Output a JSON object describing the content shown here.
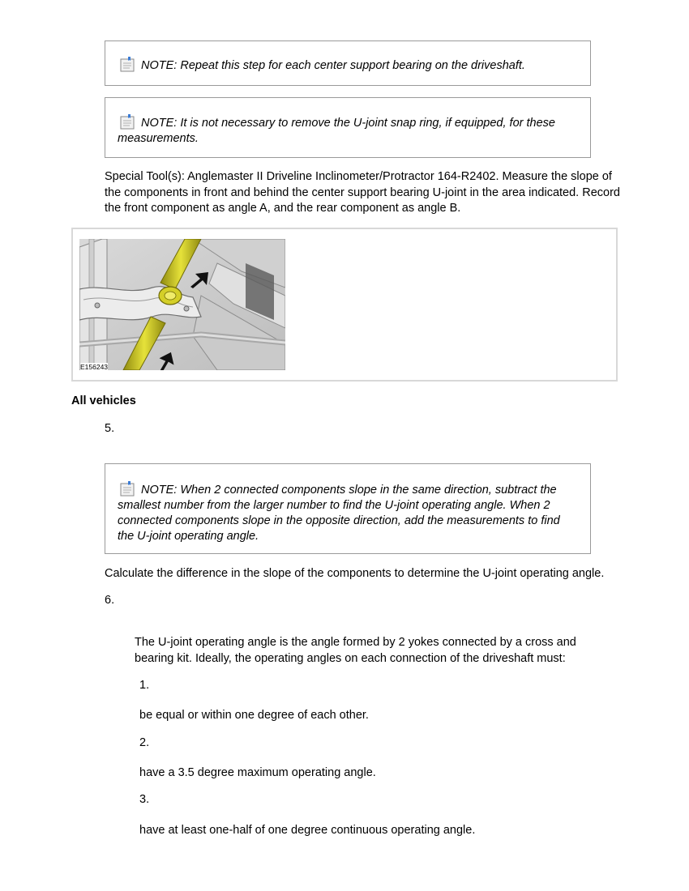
{
  "notes": [
    {
      "label": "NOTE:",
      "text": "Repeat this step for each center support bearing on the driveshaft."
    },
    {
      "label": "NOTE:",
      "text": "It is not necessary to remove the U-joint snap ring, if equipped, for these measurements."
    },
    {
      "label": "NOTE:",
      "text": "When 2 connected components slope in the same direction, subtract the smallest number from the larger number to find the U-joint operating angle. When 2 connected components slope in the opposite direction, add the measurements to find the U-joint operating angle."
    }
  ],
  "special_tool_paragraph": "Special Tool(s): Anglemaster II Driveline Inclinometer/Protractor 164-R2402. Measure the slope of the components in front and behind the center support bearing U-joint in the area indicated. Record the front component as angle A, and the rear component as angle B.",
  "figure": {
    "id": "E156243"
  },
  "section_heading": "All vehicles",
  "steps": [
    {
      "number": "5.",
      "text": "Calculate the difference in the slope of the components to determine the U-joint operating angle."
    },
    {
      "number": "6.",
      "text": "The U-joint operating angle is the angle formed by 2 yokes connected by a cross and bearing kit. Ideally, the operating angles on each connection of the driveshaft must:"
    }
  ],
  "sub_items": [
    {
      "number": "1.",
      "text": "be equal or within one degree of each other."
    },
    {
      "number": "2.",
      "text": "have a 3.5 degree maximum operating angle."
    },
    {
      "number": "3.",
      "text": "have at least one-half of one degree continuous operating angle."
    }
  ],
  "colors": {
    "driveshaft": "#c9c41a",
    "note_border": "#9a9a9a",
    "figure_border": "#d8d8d8"
  }
}
